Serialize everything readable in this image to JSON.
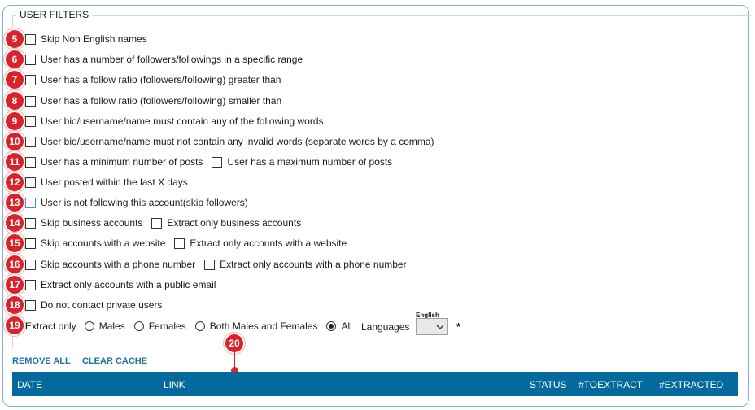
{
  "group_title": "USER FILTERS",
  "badges": [
    "5",
    "6",
    "7",
    "8",
    "9",
    "10",
    "11",
    "12",
    "13",
    "14",
    "15",
    "16",
    "17",
    "18",
    "19",
    "20"
  ],
  "filters": {
    "f5": "Skip Non English names",
    "f6": "User has a number of followers/followings in a specific range",
    "f7": "User has a follow ratio (followers/following) greater than",
    "f8": "User has a follow ratio (followers/following) smaller than",
    "f9": "User bio/username/name must contain any of the following words",
    "f10": "User bio/username/name must not contain any invalid words (separate words by a comma)",
    "f11a": "User has a minimum number of posts",
    "f11b": "User has a maximum number of posts",
    "f12": "User posted within the last X days",
    "f13": "User is not following this account(skip followers)",
    "f14a": "Skip business accounts",
    "f14b": "Extract only business accounts",
    "f15a": "Skip accounts with a website",
    "f15b": "Extract only accounts with a website",
    "f16a": "Skip accounts with a phone number",
    "f16b": "Extract only accounts with a phone number",
    "f17": "Extract only accounts with a public email",
    "f18": "Do not contact private users"
  },
  "extract": {
    "label": "Extract only",
    "options": [
      "Males",
      "Females",
      "Both Males and Females",
      "All"
    ],
    "selected": "All"
  },
  "languages": {
    "label": "Languages",
    "selected": "English",
    "required_mark": "*"
  },
  "actions": {
    "remove_all": "REMOVE ALL",
    "clear_cache": "CLEAR CACHE"
  },
  "table": {
    "columns": [
      "DATE",
      "LINK",
      "STATUS",
      "#TOEXTRACT",
      "#EXTRACTED"
    ]
  },
  "colors": {
    "accent": "#04699c",
    "badge": "#d9222a",
    "link": "#1f6fa3"
  }
}
